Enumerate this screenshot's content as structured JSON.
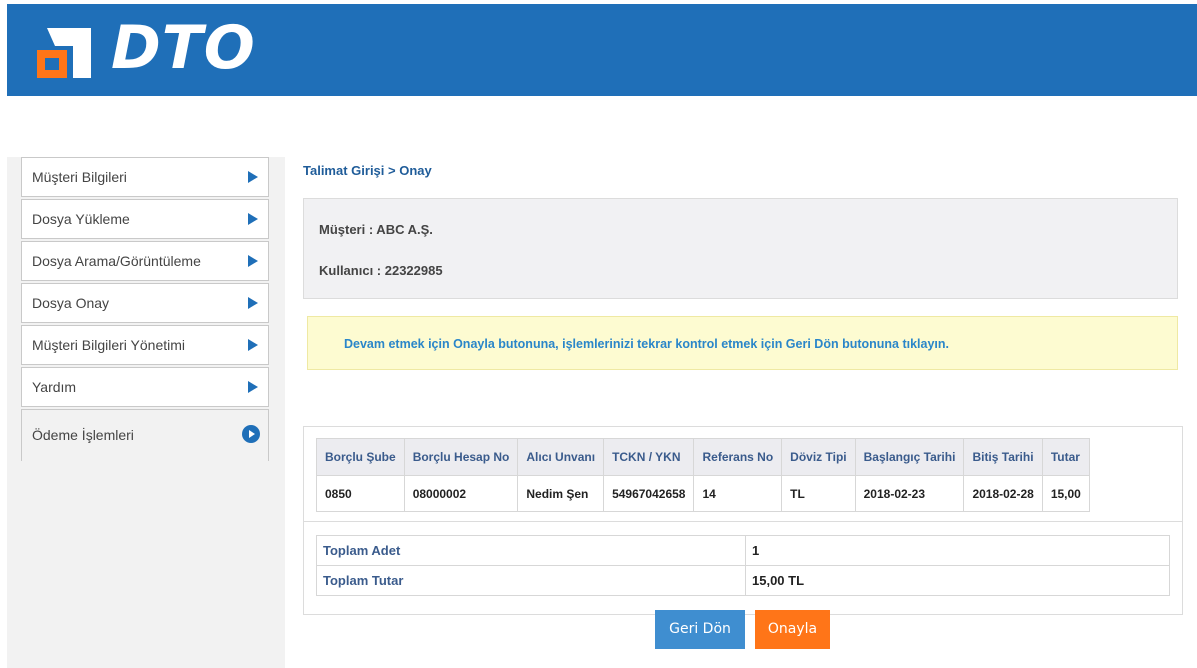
{
  "brand": {
    "logo_text": "DTO"
  },
  "sidebar": {
    "items": [
      {
        "label": "Müşteri Bilgileri"
      },
      {
        "label": "Dosya Yükleme"
      },
      {
        "label": "Dosya Arama/Görüntüleme"
      },
      {
        "label": "Dosya Onay"
      },
      {
        "label": "Müşteri Bilgileri Yönetimi"
      },
      {
        "label": "Yardım"
      },
      {
        "label": "Ödeme İşlemleri"
      }
    ]
  },
  "breadcrumb": "Talimat Girişi > Onay",
  "info": {
    "customer": "Müşteri :  ABC A.Ş.",
    "user": "Kullanıcı : 22322985"
  },
  "warning": "Devam etmek için Onayla butonuna, işlemlerinizi tekrar kontrol etmek için Geri Dön butonuna tıklayın.",
  "table": {
    "headers": [
      "Borçlu Şube",
      "Borçlu Hesap No",
      "Alıcı Unvanı",
      "TCKN / YKN",
      "Referans No",
      "Döviz Tipi",
      "Başlangıç Tarihi",
      "Bitiş Tarihi",
      "Tutar"
    ],
    "rows": [
      [
        "0850",
        "08000002",
        "Nedim Şen",
        "54967042658",
        "14",
        "TL",
        "2018-02-23",
        "2018-02-28",
        "15,00"
      ]
    ]
  },
  "summary": {
    "count_label": "Toplam Adet",
    "count_value": "1",
    "total_label": "Toplam Tutar",
    "total_value": "15,00 TL"
  },
  "buttons": {
    "back": "Geri Dön",
    "confirm": "Onayla"
  },
  "colors": {
    "brand_blue": "#1f6fb8",
    "confirm_orange": "#ff7518",
    "back_blue": "#3f8ed0"
  }
}
